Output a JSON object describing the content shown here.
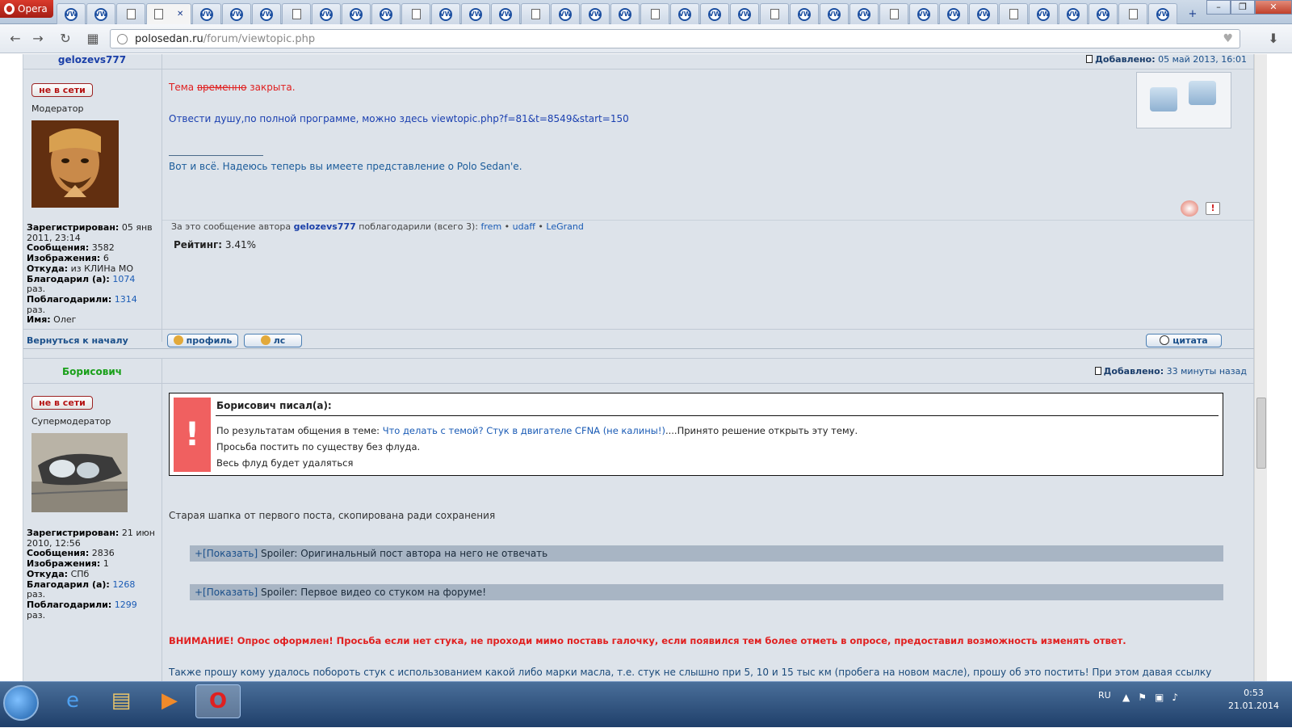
{
  "browser": {
    "menu_label": "Opera",
    "url_host": "polosedan.ru",
    "url_path": "/forum/viewtopic.php",
    "tab_count": 37
  },
  "post1": {
    "author": "gelozevs777",
    "status": "не в сети",
    "rank": "Модератор",
    "added_label": "Добавлено:",
    "added_date": "05 май 2013, 16:01",
    "text_prefix": "Тема ",
    "text_struck": "временно",
    "text_suffix": " закрыта.",
    "link_text": "Отвести душу,по полной программе, можно здесь viewtopic.php?f=81&t=8549&start=150",
    "signature": "Вот и всё. Надеюсь теперь вы имеете представление о Polo Sedan'e.",
    "thanks_prefix": "За это сообщение автора",
    "thanks_author": "gelozevs777",
    "thanks_middle": "поблагодарили (всего 3):",
    "thanks_users": [
      "frem",
      "udaff",
      "LeGrand"
    ],
    "rating_label": "Рейтинг:",
    "rating_value": "3.41%",
    "profile": {
      "registered_label": "Зарегистрирован:",
      "registered_value": "05 янв 2011, 23:14",
      "messages_label": "Сообщения:",
      "messages_value": "3582",
      "images_label": "Изображения:",
      "images_value": "6",
      "from_label": "Откуда:",
      "from_value": "из КЛИНа МО",
      "thanked_label": "Благодарил (а):",
      "thanked_value": "1074",
      "thanked_unit": "раз.",
      "got_thanks_label": "Поблагодарили:",
      "got_thanks_value": "1314",
      "got_thanks_unit": "раз.",
      "name_label": "Имя:",
      "name_value": "Олег"
    }
  },
  "actions": {
    "back_to_top": "Вернуться к началу",
    "profile_btn": "профиль",
    "pm_btn": "лс",
    "quote_btn": "цитата"
  },
  "post2": {
    "author": "Борисович",
    "status": "не в сети",
    "rank": "Супермодератор",
    "added_label": "Добавлено:",
    "added_date": "33 минуты назад",
    "quote_title": "Борисович писал(а):",
    "quote_line1_prefix": "По результатам общения в теме:",
    "quote_line1_link": "Что делать с темой? Стук в двигателе CFNA (не калины!)",
    "quote_line1_suffix": "....Принято решение открыть эту тему.",
    "quote_line2": "Просьба постить по существу без флуда.",
    "quote_line3": "Весь флуд будет удаляться",
    "old_header": "Старая шапка от первого поста, скопирована ради сохранения",
    "spoiler_show": "+[Показать]",
    "spoiler1": "Spoiler: Оригинальный пост автора на него не отвечать",
    "spoiler2": "Spoiler: Первое видео со стуком на форуме!",
    "warning": "ВНИМАНИЕ! Опрос оформлен! Просьба если нет стука, не проходи мимо поставь галочку, если появился тем более отметь в опросе, предоставил возможность изменять ответ.",
    "last_text": "Также прошу кому удалось побороть стук с использованием какой либо марки масла, т.е. стук не слышно при 5, 10 и 15 тыс км (пробега на новом масле), прошу об это постить! При этом давая ссылку",
    "profile": {
      "registered_label": "Зарегистрирован:",
      "registered_value": "21 июн 2010, 12:56",
      "messages_label": "Сообщения:",
      "messages_value": "2836",
      "images_label": "Изображения:",
      "images_value": "1",
      "from_label": "Откуда:",
      "from_value": "СПб",
      "thanked_label": "Благодарил (а):",
      "thanked_value": "1268",
      "thanked_unit": "раз.",
      "got_thanks_label": "Поблагодарили:",
      "got_thanks_value": "1299",
      "got_thanks_unit": "раз."
    }
  },
  "taskbar": {
    "lang": "RU",
    "time": "0:53",
    "date": "21.01.2014"
  },
  "colors": {
    "forum_bg": "#dde3ea",
    "link": "#1a5bb5",
    "warning": "#e02020",
    "author2": "#1aa01a"
  }
}
